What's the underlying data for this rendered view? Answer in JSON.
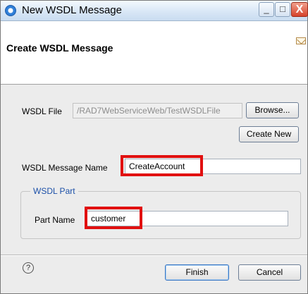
{
  "window": {
    "title": "New WSDL Message",
    "icon": "wsdl-app-icon",
    "minimize_glyph": "_",
    "maximize_glyph": "□",
    "close_glyph": "X"
  },
  "header": {
    "title": "Create WSDL Message",
    "icon": "envelope-icon"
  },
  "form": {
    "wsdl_file_label": "WSDL File",
    "wsdl_file_value": "/RAD7WebServiceWeb/TestWSDLFile",
    "browse_label": "Browse...",
    "create_new_label": "Create New",
    "message_name_label": "WSDL Message Name",
    "message_name_value": "CreateAccount"
  },
  "wsdl_part": {
    "legend": "WSDL Part",
    "part_name_label": "Part Name",
    "part_name_value": "customer"
  },
  "footer": {
    "help_glyph": "?",
    "finish_label": "Finish",
    "cancel_label": "Cancel"
  },
  "colors": {
    "highlight": "#e11010",
    "group_legend": "#1c50a8",
    "close_button": "#d5432b"
  }
}
